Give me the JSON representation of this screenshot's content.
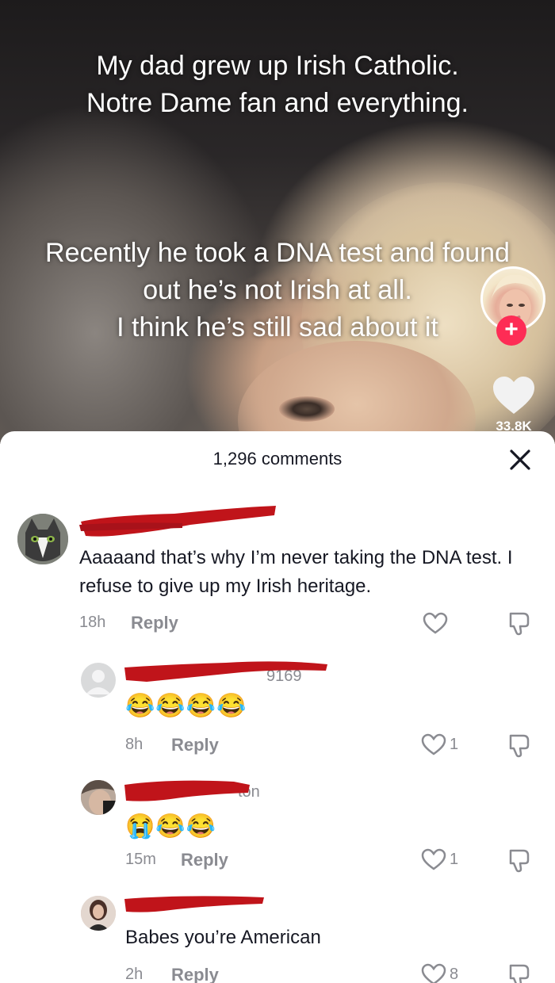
{
  "video": {
    "caption_top": "My dad grew up Irish Catholic.\nNotre Dame fan and everything.",
    "caption_bottom": "Recently he took a DNA test and found out he’s not Irish at all.\nI think he’s still sad about it",
    "like_count": "33.8K",
    "follow_symbol": "+"
  },
  "comments_sheet": {
    "title": "1,296 comments",
    "close_symbol": "✕"
  },
  "comments": [
    {
      "username_visible": "",
      "text": "Aaaaand that’s why I’m never taking the DNA test. I refuse to give up my Irish heritage.",
      "time": "18h",
      "reply_label": "Reply",
      "likes": ""
    },
    {
      "username_visible": "9169",
      "text": "😂😂😂😂",
      "time": "8h",
      "reply_label": "Reply",
      "likes": "1"
    },
    {
      "username_visible": "ton",
      "text": "😭😂😂",
      "time": "15m",
      "reply_label": "Reply",
      "likes": "1"
    },
    {
      "username_visible": "",
      "text": "Babes you’re American",
      "time": "2h",
      "reply_label": "Reply",
      "likes": "8"
    }
  ],
  "colors": {
    "accent": "#fe2c55",
    "redaction": "#c0141a",
    "muted_text": "#8a8b91",
    "primary_text": "#161823"
  },
  "icons": [
    "heart-icon",
    "dislike-icon",
    "close-icon",
    "plus-icon",
    "avatar"
  ]
}
